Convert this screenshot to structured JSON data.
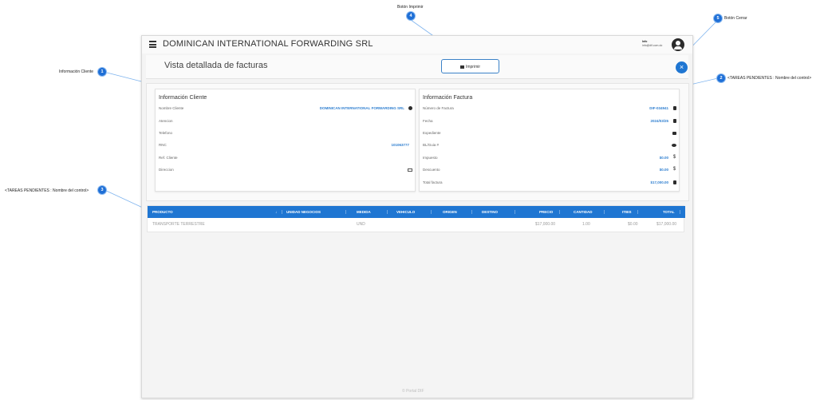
{
  "app": {
    "company_name": "DOMINICAN INTERNATIONAL FORWARDING SRL",
    "user_name": "Info",
    "user_email": "info@dif.com.do",
    "footer": "© Portal DIF"
  },
  "header": {
    "page_title": "Vista detallada de facturas",
    "print_label": "Imprimir",
    "close_label": "×"
  },
  "client_info": {
    "title": "Información Cliente",
    "rows": [
      {
        "label": "Nombre Cliente",
        "value": "DOMINICAN INTERNATIONAL FORWARDING SRL",
        "icon": "info-circle-icon"
      },
      {
        "label": "Atencion",
        "value": ""
      },
      {
        "label": "Telefono",
        "value": ""
      },
      {
        "label": "RNC",
        "value": "101063777"
      },
      {
        "label": "Ref. Cliente",
        "value": ""
      },
      {
        "label": "Direccion",
        "value": "",
        "icon": "address-card-icon"
      }
    ]
  },
  "invoice_info": {
    "title": "Información Factura",
    "rows": [
      {
        "label": "Número de Factura",
        "value": "DIF-034941",
        "icon": "file-icon"
      },
      {
        "label": "Fecha",
        "value": "2024/03/25",
        "icon": "calendar-icon"
      },
      {
        "label": "Expediente",
        "value": "",
        "icon": "folder-icon"
      },
      {
        "label": "BL/Guia #",
        "value": "",
        "icon": "gears-icon"
      },
      {
        "label": "Impuesto",
        "value": "$0.00",
        "icon": "dollar-icon"
      },
      {
        "label": "Descuento",
        "value": "$0.00",
        "icon": "dollar-icon"
      },
      {
        "label": "Total factura",
        "value": "$17,000.00",
        "icon": "file-invoice-icon"
      }
    ]
  },
  "table": {
    "headers": [
      "PRODUCTO",
      "UNIDAD NEGOCIOS",
      "MEDIDA",
      "VEHICULO",
      "ORIGEN",
      "DESTINO",
      "PRECIO",
      "CANTIDAD",
      "ITBIS",
      "TOTAL"
    ],
    "rows": [
      [
        "TRANSPORTE TERRESTRE",
        "",
        "UND",
        "",
        "",
        "",
        "$17,000.00",
        "1.00",
        "$0.00",
        "$17,000.00"
      ]
    ]
  },
  "annotations": [
    {
      "number": "1",
      "text": "Información Cliente"
    },
    {
      "number": "2",
      "text": "<TAREAS PENDIENTES : Nombre del control>"
    },
    {
      "number": "3",
      "text": "<TAREAS PENDIENTES : Nombre del control>"
    },
    {
      "number": "4",
      "text": "Botón Imprimir"
    },
    {
      "number": "5",
      "text": "Botón Cerrar"
    }
  ],
  "colors": {
    "accent": "#1f76d2",
    "value_blue": "#2f7fd0",
    "badge": "#1f6fd6"
  }
}
